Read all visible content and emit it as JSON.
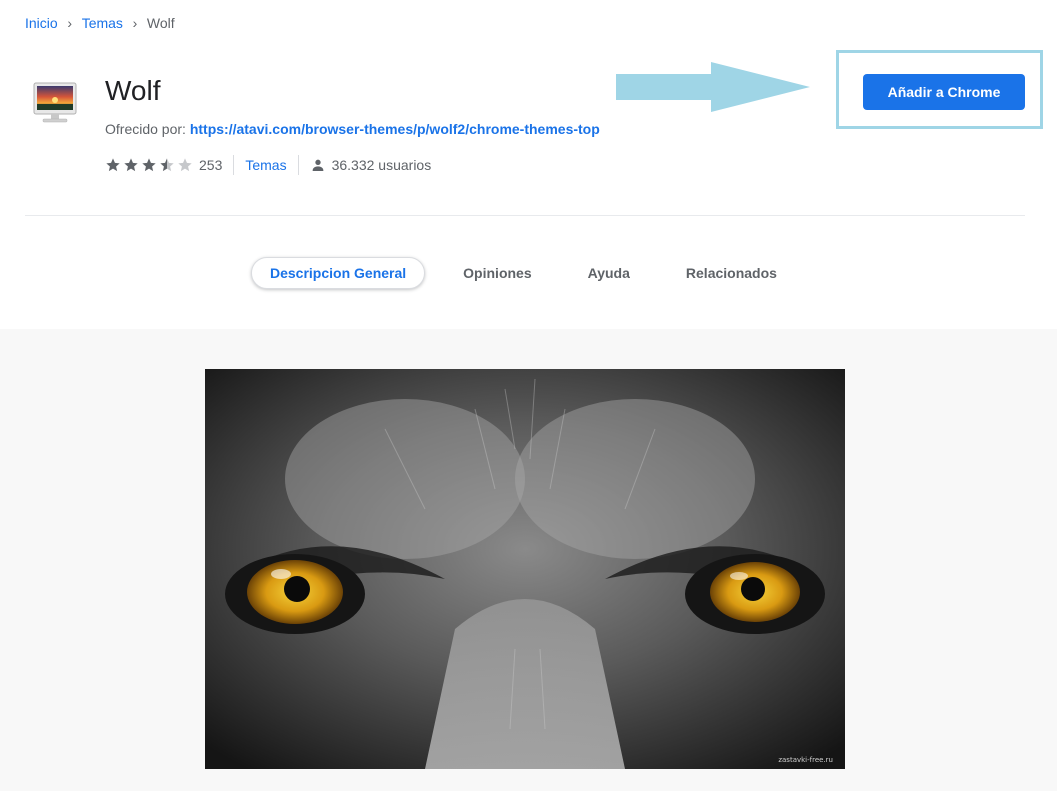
{
  "breadcrumb": {
    "items": [
      "Inicio",
      "Temas"
    ],
    "current": "Wolf"
  },
  "header": {
    "title": "Wolf",
    "offered_by_label": "Ofrecido por:",
    "offered_by_link": "https://atavi.com/browser-themes/p/wolf2/chrome-themes-top",
    "rating_value": 3.5,
    "rating_count": "253",
    "category": "Temas",
    "users": "36.332 usuarios",
    "icon": "monitor-sunset-icon"
  },
  "actions": {
    "add_button": "Añadir a Chrome"
  },
  "tabs": [
    {
      "label": "Descripcion General",
      "active": true
    },
    {
      "label": "Opiniones",
      "active": false
    },
    {
      "label": "Ayuda",
      "active": false
    },
    {
      "label": "Relacionados",
      "active": false
    }
  ],
  "gallery": {
    "image": "wolf-eyes-closeup",
    "watermark": "zastavki-free.ru"
  },
  "colors": {
    "accent": "#1a73e8",
    "highlight": "#9fd5e6",
    "gallery_bg": "#f8f8f8"
  }
}
